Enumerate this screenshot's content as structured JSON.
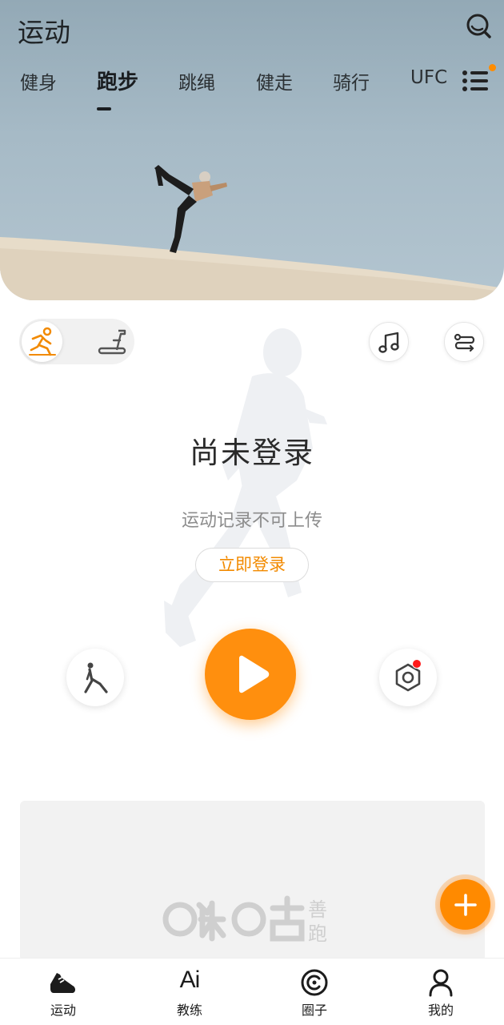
{
  "header": {
    "title": "运动",
    "icons": {
      "search": "search-icon",
      "menu": "list-menu-icon"
    },
    "menu_badge_color": "#ff8c00"
  },
  "tabs": [
    {
      "label": "健身",
      "active": false
    },
    {
      "label": "跑步",
      "active": true
    },
    {
      "label": "跳绳",
      "active": false
    },
    {
      "label": "健走",
      "active": false
    },
    {
      "label": "骑行",
      "active": false
    },
    {
      "label": "UFC",
      "active": false
    }
  ],
  "mode_switch": {
    "options": [
      {
        "icon": "outdoor-run-icon",
        "selected": true
      },
      {
        "icon": "treadmill-icon",
        "selected": false
      }
    ]
  },
  "top_buttons": {
    "music_icon": "music-note-icon",
    "settings_icon": "route-settings-icon"
  },
  "login": {
    "title": "尚未登录",
    "subtitle": "运动记录不可上传",
    "button_label": "立即登录"
  },
  "actions": {
    "left_icon": "warmup-stretch-icon",
    "start_icon": "play-icon",
    "right_icon": "hex-nut-settings-icon",
    "right_has_notification": true
  },
  "banner": {
    "logo_text": "咪咕",
    "logo_subtext": "善跑"
  },
  "fab": {
    "icon": "plus-icon"
  },
  "bottom_nav": [
    {
      "label": "运动",
      "icon": "sneaker-icon"
    },
    {
      "label": "教练",
      "icon": "ai-coach-icon",
      "glyph": "Ai"
    },
    {
      "label": "圈子",
      "icon": "circle-community-icon"
    },
    {
      "label": "我的",
      "icon": "person-icon"
    }
  ],
  "colors": {
    "accent": "#ff8f0e",
    "login_text": "#f28a00",
    "notification": "#ff1a1a",
    "hero_sky": "#a6bac6"
  }
}
